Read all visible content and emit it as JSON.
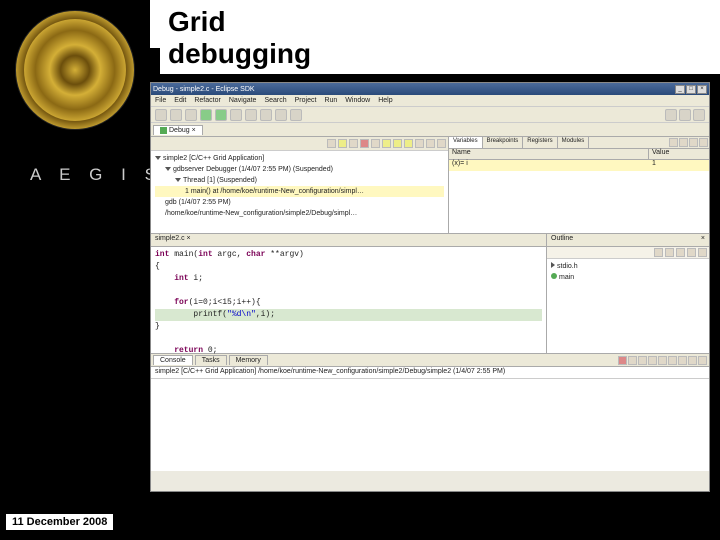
{
  "slide": {
    "title": "Grid debugging",
    "org": "A E G I S",
    "date": "11 December 2008"
  },
  "window": {
    "title": "Debug - simple2.c - Eclipse SDK",
    "menus": [
      "File",
      "Edit",
      "Refactor",
      "Navigate",
      "Search",
      "Project",
      "Run",
      "Window",
      "Help"
    ]
  },
  "debug": {
    "tab": "Debug",
    "nodes": {
      "app": "simple2 [C/C++ Grid Application]",
      "gdb": "gdbserver Debugger (1/4/07 2:55 PM) (Suspended)",
      "thread": "Thread [1] (Suspended)",
      "frame": "1 main() at /home/koe/runtime-New_configuration/simpl…",
      "proc1": "gdb (1/4/07 2:55 PM)",
      "proc2": "/home/koe/runtime-New_configuration/simple2/Debug/simpl…"
    }
  },
  "vars": {
    "tabs": [
      "Variables",
      "Breakpoints",
      "Registers",
      "Modules"
    ],
    "head_name": "Name",
    "head_val": "Value",
    "row_name": "(x)= i",
    "row_val": "1"
  },
  "source": {
    "file": "simple2.c",
    "lines": {
      "l1": "int main(int argc, char **argv)",
      "l2": "{",
      "l3": "    int i;",
      "l4": "",
      "l5": "    for(i=0;i<15;i++){",
      "l6": "        printf(\"%d\\n\",i);",
      "l7": "    }",
      "l8": "",
      "l9": "    return 0;"
    }
  },
  "outline": {
    "tab": "Outline",
    "items": {
      "inc": "stdio.h",
      "fn": "main"
    }
  },
  "console": {
    "tabs": [
      "Console",
      "Tasks",
      "Memory"
    ],
    "line": "simple2 [C/C++ Grid Application]  /home/koe/runtime-New_configuration/simple2/Debug/simple2 (1/4/07 2:55 PM)"
  }
}
